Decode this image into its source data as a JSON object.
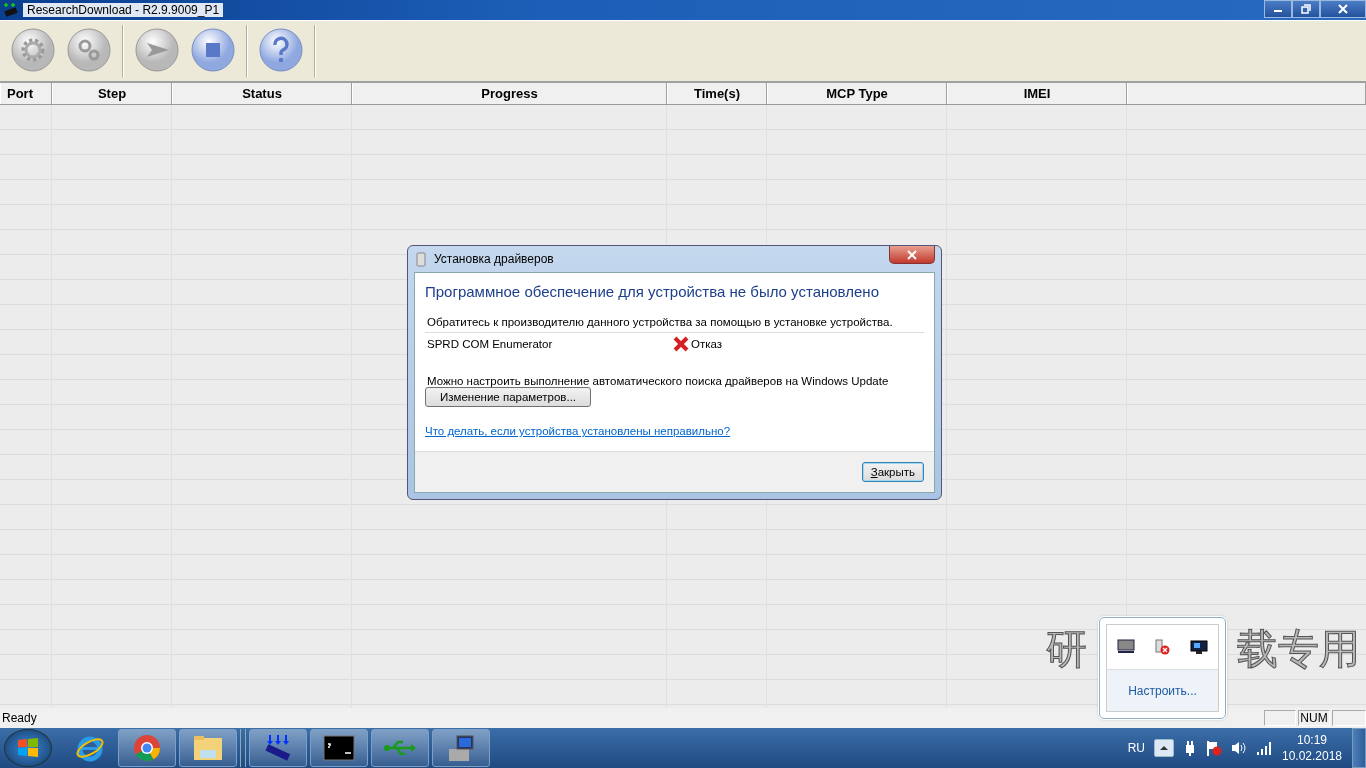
{
  "window": {
    "title": "ResearchDownload - R2.9.9009_P1"
  },
  "table": {
    "columns": [
      "Port",
      "Step",
      "Status",
      "Progress",
      "Time(s)",
      "MCP Type",
      "IMEI"
    ]
  },
  "background_text": [
    "研",
    "载专用"
  ],
  "dialog": {
    "title": "Установка драйверов",
    "heading": "Программное обеспечение для устройства не было установлено",
    "message": "Обратитесь к производителю данного устройства за помощью в установке устройства.",
    "device": {
      "name": "SPRD COM Enumerator",
      "status": "Отказ"
    },
    "note": "Можно настроить выполнение автоматического поиска драйверов на Windows Update",
    "settings_button": "Изменение параметров...",
    "link": "Что делать, если устройства установлены неправильно?",
    "close_button": "Закрыть"
  },
  "tray_popup": {
    "link": "Настроить..."
  },
  "status_bar": {
    "text": "Ready",
    "panels": [
      {
        "text": "NUM"
      }
    ]
  },
  "taskbar": {
    "language": "RU",
    "time": "10:19",
    "date": "10.02.2018"
  }
}
